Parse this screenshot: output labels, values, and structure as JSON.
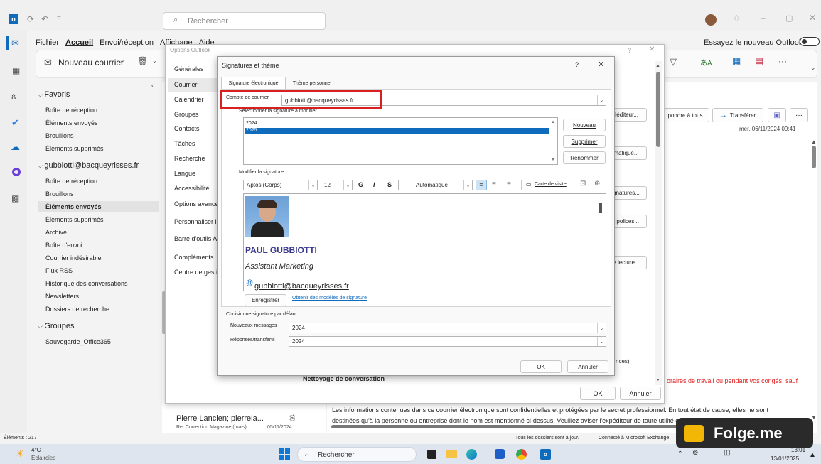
{
  "titlebar": {
    "search_placeholder": "Rechercher"
  },
  "ribbon": {
    "tabs": [
      {
        "label": "Fichier",
        "active": false
      },
      {
        "label": "Accueil",
        "active": true
      },
      {
        "label": "Envoi/réception",
        "active": false
      },
      {
        "label": "Affichage",
        "active": false
      },
      {
        "label": "Aide",
        "active": false
      }
    ],
    "new_mail": "Nouveau courrier",
    "try_new": "Essayez le nouveau Outlook"
  },
  "folders": [
    {
      "label": "Favoris",
      "type": "section"
    },
    {
      "label": "Boîte de réception",
      "type": "item"
    },
    {
      "label": "Éléments envoyés",
      "type": "item"
    },
    {
      "label": "Brouillons",
      "type": "item"
    },
    {
      "label": "Éléments supprimés",
      "type": "item"
    },
    {
      "label": "gubbiotti@bacqueyrisses.fr",
      "type": "section"
    },
    {
      "label": "Boîte de réception",
      "type": "item"
    },
    {
      "label": "Brouillons",
      "type": "item"
    },
    {
      "label": "Éléments envoyés",
      "type": "selected"
    },
    {
      "label": "Éléments supprimés",
      "type": "item"
    },
    {
      "label": "Archive",
      "type": "item"
    },
    {
      "label": "Boîte d'envoi",
      "type": "item"
    },
    {
      "label": "Courrier indésirable",
      "type": "item"
    },
    {
      "label": "Flux RSS",
      "type": "item"
    },
    {
      "label": "Historique des conversations",
      "type": "item"
    },
    {
      "label": "Newsletters",
      "type": "item"
    },
    {
      "label": "Dossiers de recherche",
      "type": "item"
    },
    {
      "label": "Groupes",
      "type": "section"
    },
    {
      "label": "Sauvegarde_Office365",
      "type": "item"
    }
  ],
  "message": {
    "sender": "Pierre Lancien; pierrela...",
    "subject": "Re: Correction Magazine (mais)",
    "date": "05/11/2024"
  },
  "reading": {
    "reply_all": "pondre à tous",
    "forward": "Transférer",
    "date": "mer. 06/11/2024 09:41",
    "red_text": "oraires de travail ou pendant vos congés, sauf",
    "body1": "Les informations contenues dans ce courrier électronique sont confidentielles et protégées par le secret professionnel. En tout état de cause, elles ne sont",
    "body2": "destinées qu'à la personne ou entreprise dont le nom est mentionné ci-dessus. Veuillez aviser l'expéditeur de toute utilité ou de toute erreur dans la"
  },
  "options": {
    "title": "Options Outlook",
    "categories": [
      "Générales",
      "Courrier",
      "Calendrier",
      "Groupes",
      "Contacts",
      "Tâches",
      "Recherche",
      "Langue",
      "Accessibilité",
      "Options avancées",
      "Personnaliser le Ruban",
      "Barre d'outils Accès rapide",
      "Compléments",
      "Centre de gestion de la confidentialité"
    ],
    "right_buttons": [
      "l'éditeur...",
      "matique...",
      "gnatures...",
      "t polices...",
      "e lecture..."
    ],
    "nettoyage": "Nettoyage de conversation",
    "nces": "nces)",
    "ok": "OK",
    "cancel": "Annuler"
  },
  "sig": {
    "title": "Signatures et thème",
    "tabs": [
      "Signature électronique",
      "Thème personnel"
    ],
    "account_label": "Compte de courrier",
    "account": "gubbiotti@bacqueyrisses.fr",
    "select_label": "Sélectionner la signature à modifier",
    "list": [
      "2024",
      "2025"
    ],
    "btn_new": "Nouveau",
    "btn_delete": "Supprimer",
    "btn_rename": "Renommer",
    "edit_label": "Modifier la signature",
    "font": "Aptos (Corps)",
    "size": "12",
    "color": "Automatique",
    "card": "Carte de visite",
    "name": "PAUL GUBBIOTTI",
    "role": "Assistant Marketing",
    "email": "gubbiotti@bacqueyrisses.fr",
    "save": "Enregistrer",
    "templates": "Obtenir des modèles de signature",
    "default_label": "Choisir une signature par défaut",
    "new_msg_label": "Nouveaux messages :",
    "new_msg": "2024",
    "reply_label": "Réponses/transferts :",
    "reply": "2024",
    "ok": "OK",
    "cancel": "Annuler"
  },
  "status": {
    "items": "Éléments : 217",
    "synced": "Tous les dossiers sont à jour.",
    "connected": "Connecté à Microsoft Exchange"
  },
  "taskbar": {
    "temp": "4°C",
    "weather": "Eclaircies",
    "search": "Rechercher",
    "time": "13:01",
    "date": "13/01/2025"
  },
  "watermark": "Folge.me"
}
